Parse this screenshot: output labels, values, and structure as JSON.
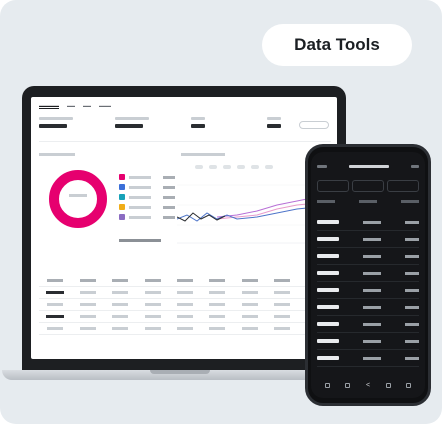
{
  "badge": {
    "label": "Data Tools"
  },
  "colors": {
    "background": "#e6ebef",
    "accent": "#e6006f",
    "legend": [
      "#e6006f",
      "#3b6fd8",
      "#17a2b8",
      "#f0ad18",
      "#8b6cc2"
    ],
    "chart_lines": [
      "#b86fd6",
      "#e89acb",
      "#4d74c9",
      "#2a2d31"
    ]
  },
  "icons": [
    "share-icon"
  ]
}
